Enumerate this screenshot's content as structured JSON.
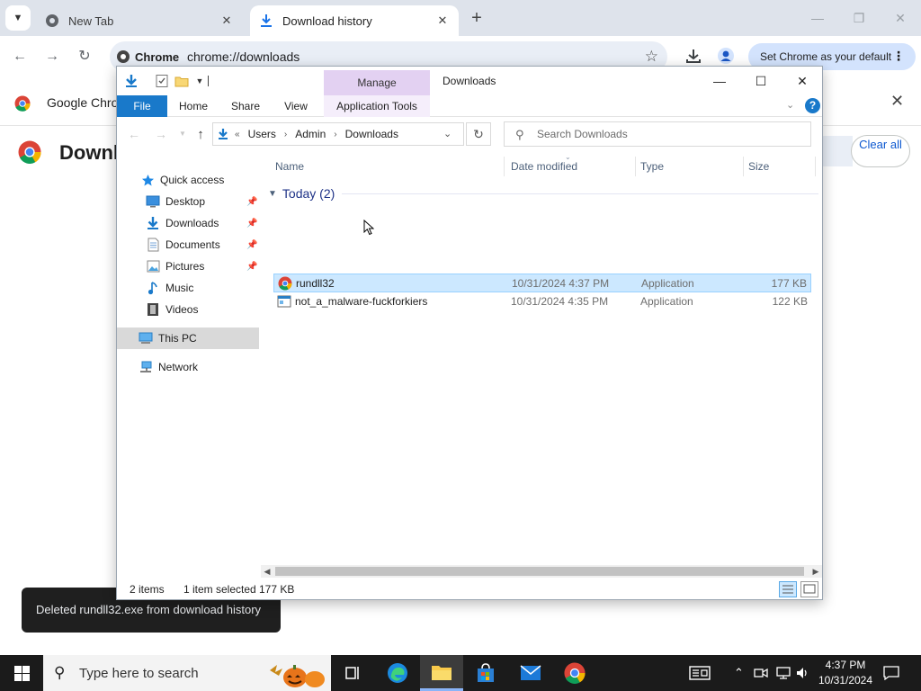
{
  "chrome": {
    "tabs": [
      {
        "title": "New Tab",
        "icon": "chrome-icon",
        "active": false
      },
      {
        "title": "Download history",
        "icon": "download-icon",
        "active": true
      }
    ],
    "url_chip": "Chrome",
    "url": "chrome://downloads",
    "default_button": "Set Chrome as your default",
    "infobar_text": "Google Chrom",
    "page_title": "Downl",
    "clear_all": "Clear all",
    "toast": "Deleted rundll32.exe from download history",
    "colors": {
      "tabstrip": "#dee3eb",
      "omnibox": "#e9eef6",
      "default_button": "#d3e3fd",
      "link": "#0b57d0"
    }
  },
  "explorer": {
    "title": "Downloads",
    "manage": "Manage",
    "ribbon_tabs": [
      "File",
      "Home",
      "Share",
      "View",
      "Application Tools"
    ],
    "breadcrumb": [
      "Users",
      "Admin",
      "Downloads"
    ],
    "breadcrumb_overflow": "«",
    "search_placeholder": "Search Downloads",
    "nav": [
      {
        "label": "Quick access",
        "icon": "star-icon",
        "pinned": false
      },
      {
        "label": "Desktop",
        "icon": "desktop-icon",
        "pinned": true
      },
      {
        "label": "Downloads",
        "icon": "download-icon",
        "pinned": true
      },
      {
        "label": "Documents",
        "icon": "document-icon",
        "pinned": true
      },
      {
        "label": "Pictures",
        "icon": "pictures-icon",
        "pinned": true
      },
      {
        "label": "Music",
        "icon": "music-icon",
        "pinned": false
      },
      {
        "label": "Videos",
        "icon": "video-icon",
        "pinned": false
      },
      {
        "label": "This PC",
        "icon": "computer-icon",
        "pinned": false,
        "selected": true
      },
      {
        "label": "Network",
        "icon": "network-icon",
        "pinned": false
      }
    ],
    "columns": [
      "Name",
      "Date modified",
      "Type",
      "Size"
    ],
    "group": "Today (2)",
    "files": [
      {
        "name": "rundll32",
        "date": "10/31/2024 4:37 PM",
        "type": "Application",
        "size": "177 KB",
        "icon": "chrome-app-icon",
        "selected": true
      },
      {
        "name": "not_a_malware-fuckforkiers",
        "date": "10/31/2024 4:35 PM",
        "type": "Application",
        "size": "122 KB",
        "icon": "exe-app-icon",
        "selected": false
      }
    ],
    "status": {
      "items": "2 items",
      "selected": "1 item selected",
      "size": "177 KB"
    },
    "colors": {
      "file_tab": "#1979ca",
      "manage": "#e3d1f2",
      "selection": "#cce8ff",
      "group": "#1e3287"
    }
  },
  "taskbar": {
    "search_placeholder": "Type here to search",
    "time": "4:37 PM",
    "date": "10/31/2024",
    "colors": {
      "background": "#1b1b1b",
      "active": "#8ab4f8"
    }
  }
}
